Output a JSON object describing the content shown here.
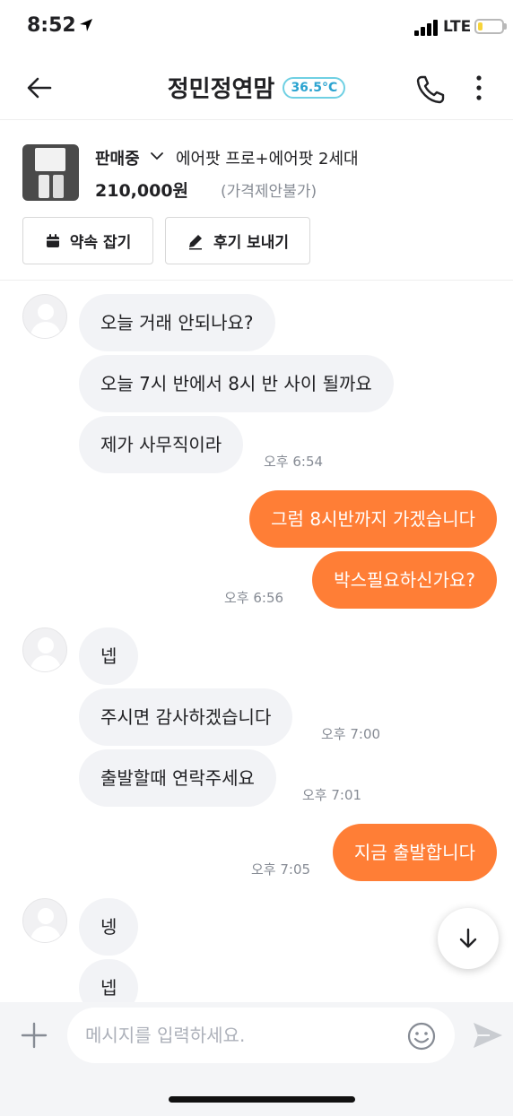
{
  "status_bar": {
    "time": "8:52",
    "network": "LTE",
    "battery_level": 0.2
  },
  "header": {
    "title": "정민정연맘",
    "manner_temp": "36.5°C"
  },
  "product": {
    "status": "판매중",
    "name": "에어팟 프로+에어팟 2세대",
    "price": "210,000원",
    "price_note": "(가격제안불가)",
    "buttons": {
      "promise": "약속 잡기",
      "review": "후기 보내기"
    }
  },
  "messages": [
    {
      "text": "오늘 거래 안되나요?"
    },
    {
      "text": "오늘 7시 반에서 8시 반 사이 될까요"
    },
    {
      "text": "제가 사무직이라",
      "time": "오후 6:54"
    },
    {
      "text": "그럼 8시반까지 가겠습니다"
    },
    {
      "text": "박스필요하신가요?",
      "time": "오후 6:56"
    },
    {
      "text": "넵"
    },
    {
      "text": "주시면 감사하겠습니다",
      "time": "오후 7:00"
    },
    {
      "text": "출발할때 연락주세요",
      "time": "오후 7:01"
    },
    {
      "text": "지금 출발합니다",
      "time": "오후 7:05"
    },
    {
      "text": "넹"
    },
    {
      "text": "넵"
    }
  ],
  "input": {
    "placeholder": "메시지를 입력하세요."
  },
  "colors": {
    "accent": "#ff7e36",
    "received_bubble": "#f2f3f6",
    "temp": "#2ba3d0"
  }
}
